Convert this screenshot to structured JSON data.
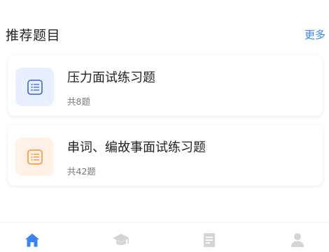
{
  "section": {
    "title": "推荐题目",
    "more_label": "更多"
  },
  "cards": [
    {
      "title": "压力面试练习题",
      "count_label": "共8题",
      "icon": "list-icon",
      "icon_bg": "#e8f0ff",
      "icon_color": "#4a78d6"
    },
    {
      "title": "串词、编故事面试练习题",
      "count_label": "共42题",
      "icon": "list-icon",
      "icon_bg": "#fff1e6",
      "icon_color": "#f0a04a"
    }
  ],
  "tab_bar": {
    "items": [
      {
        "icon": "home-icon",
        "active": true
      },
      {
        "icon": "graduation-cap-icon",
        "active": false
      },
      {
        "icon": "document-icon",
        "active": false
      },
      {
        "icon": "user-icon",
        "active": false
      }
    ],
    "active_color": "#3b82f6",
    "inactive_color": "#d4d4d4"
  }
}
